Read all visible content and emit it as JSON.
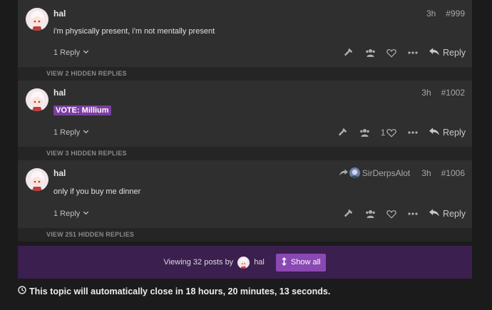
{
  "posts": [
    {
      "username": "hal",
      "age": "3h",
      "number": "#999",
      "body": "i'm physically present, i'm not mentally present",
      "replies_label": "1 Reply",
      "reply_label": "Reply",
      "hidden_bar": "VIEW 2 HIDDEN REPLIES"
    },
    {
      "username": "hal",
      "age": "3h",
      "number": "#1002",
      "body": "VOTE: Millium",
      "replies_label": "1 Reply",
      "like_count": "1",
      "reply_label": "Reply",
      "hidden_bar": "VIEW 3 HIDDEN REPLIES"
    },
    {
      "username": "hal",
      "age": "3h",
      "number": "#1006",
      "reply_to": "SirDerpsAlot",
      "body": "only if you buy me dinner",
      "replies_label": "1 Reply",
      "reply_label": "Reply",
      "hidden_bar": "VIEW 251 HIDDEN REPLIES"
    }
  ],
  "viewing": {
    "prefix": "Viewing 32 posts by",
    "username": "hal",
    "show_all_label": "Show all"
  },
  "topic_close_notice": "This topic will automatically close in 18 hours, 20 minutes, 13 seconds.",
  "icons": {
    "replies_toggle": "chevron-down-icon",
    "moderate": "hammer-icon",
    "users": "users-icon",
    "like": "heart-icon",
    "more": "ellipsis-icon",
    "reply": "reply-icon",
    "reply_to": "share-arrow-icon",
    "show_all": "expand-vertical-icon",
    "clock": "clock-icon"
  },
  "colors": {
    "page_bg": "#1b1b1b",
    "post_bg": "#2f2f2f",
    "vote_highlight": "#7a3fa0",
    "viewing_bg": "#3b1f4f",
    "show_all_bg": "#8a48b3"
  }
}
